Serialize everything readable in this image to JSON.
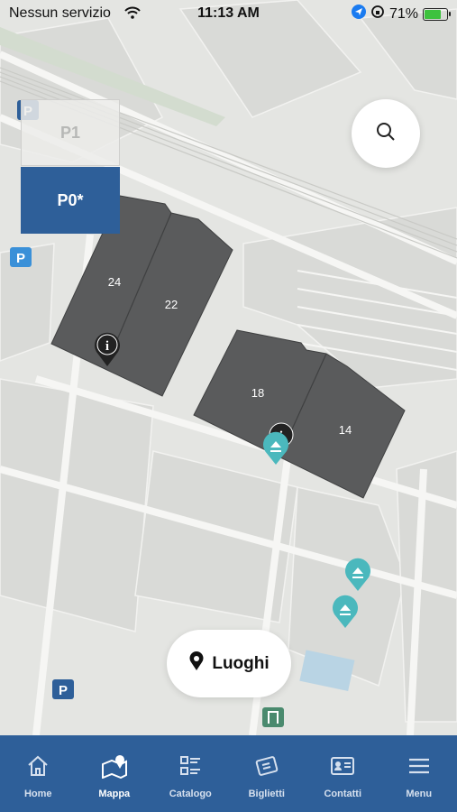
{
  "status_bar": {
    "carrier": "Nessun servizio",
    "time": "11:13 AM",
    "battery": "71%"
  },
  "floors": [
    {
      "label": "P1"
    },
    {
      "label": "P0*"
    }
  ],
  "buildings": {
    "b24": "24",
    "b22": "22",
    "b18": "18",
    "b14": "14"
  },
  "places_button": {
    "label": "Luoghi"
  },
  "tabs": [
    {
      "label": "Home",
      "icon": "home-icon"
    },
    {
      "label": "Mappa",
      "icon": "map-icon"
    },
    {
      "label": "Catalogo",
      "icon": "catalog-icon"
    },
    {
      "label": "Biglietti",
      "icon": "tickets-icon"
    },
    {
      "label": "Contatti",
      "icon": "contacts-icon"
    },
    {
      "label": "Menu",
      "icon": "menu-icon"
    }
  ],
  "colors": {
    "primary": "#2e5f99",
    "building": "#5a5b5c",
    "teal_marker": "#4bb8bd",
    "map_bg": "#e4e5e2"
  }
}
